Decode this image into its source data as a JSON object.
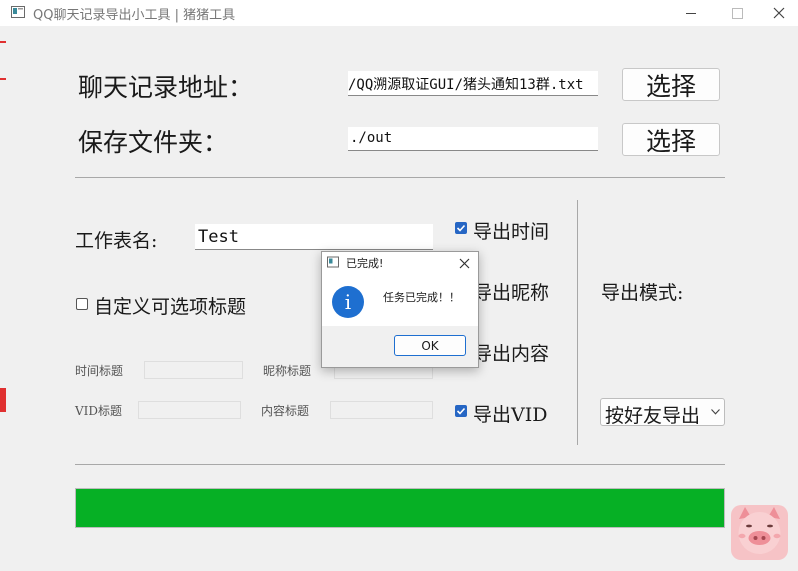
{
  "window": {
    "title": "QQ聊天记录导出小工具 | 猪猪工具",
    "min_icon": "minimize-icon",
    "max_icon": "maximize-icon",
    "close_icon": "close-icon"
  },
  "form": {
    "chat_path_label": "聊天记录地址：",
    "chat_path_value": "/QQ溯源取证GUI/猪头通知13群.txt",
    "choose_label_1": "选择",
    "save_folder_label": "保存文件夹：",
    "save_folder_value": "./out",
    "choose_label_2": "选择",
    "sheet_name_label": "工作表名:",
    "sheet_name_value": "Test",
    "custom_title_label": "自定义可选项标题",
    "custom_title_checked": false,
    "time_title_label": "时间标题",
    "nick_title_label": "昵称标题",
    "vid_title_label": "VID标题",
    "content_title_label": "内容标题",
    "export_time_label": "导出时间",
    "export_time_checked": true,
    "export_nick_label": "导出昵称",
    "export_content_label": "导出内容",
    "export_vid_label": "导出VID",
    "export_vid_checked": true,
    "export_mode_label": "导出模式:",
    "export_mode_value": "按好友导出"
  },
  "progress": {
    "value": 1.0,
    "color": "#06b025"
  },
  "dialog": {
    "title": "已完成!",
    "message": "任务已完成！！",
    "ok_label": "OK",
    "info_icon_text": "i",
    "accent": "#1e6fd0"
  },
  "mascot": {
    "icon": "pig-icon"
  }
}
